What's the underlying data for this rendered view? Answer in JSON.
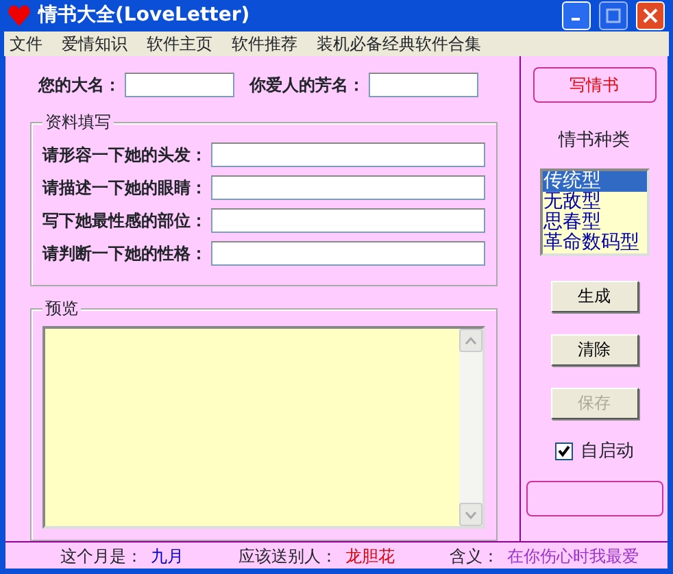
{
  "window": {
    "title": "情书大全(LoveLetter)"
  },
  "menu": [
    "文件",
    "爱情知识",
    "软件主页",
    "软件推荐",
    "装机必备经典软件合集"
  ],
  "names": [
    {
      "label": "您的大名："
    },
    {
      "label": "你爱人的芳名："
    }
  ],
  "details": {
    "title": "资料填写",
    "fields": [
      {
        "label": "请形容一下她的头发："
      },
      {
        "label": "请描述一下她的眼睛："
      },
      {
        "label": "写下她最性感的部位："
      },
      {
        "label": "请判断一下她的性格："
      }
    ]
  },
  "preview": {
    "title": "预览"
  },
  "write_button": "写情书",
  "types_label": "情书种类",
  "types": [
    {
      "label": "传统型",
      "selected": true
    },
    {
      "label": "无敌型",
      "selected": false
    },
    {
      "label": "思春型",
      "selected": false
    },
    {
      "label": "革命数码型",
      "selected": false
    }
  ],
  "buttons": [
    {
      "label": "生成",
      "disabled": false
    },
    {
      "label": "清除",
      "disabled": false
    },
    {
      "label": "保存",
      "disabled": true
    }
  ],
  "autostart": {
    "label": "自启动",
    "checked": true
  },
  "status": [
    {
      "label": "这个月是：",
      "value": "九月",
      "color": "#0000cc"
    },
    {
      "label": "应该送别人：",
      "value": "龙胆花",
      "color": "#dd0000"
    },
    {
      "label": "含义：",
      "value": "在你伤心时我最爱",
      "color": "#9933cc"
    }
  ]
}
